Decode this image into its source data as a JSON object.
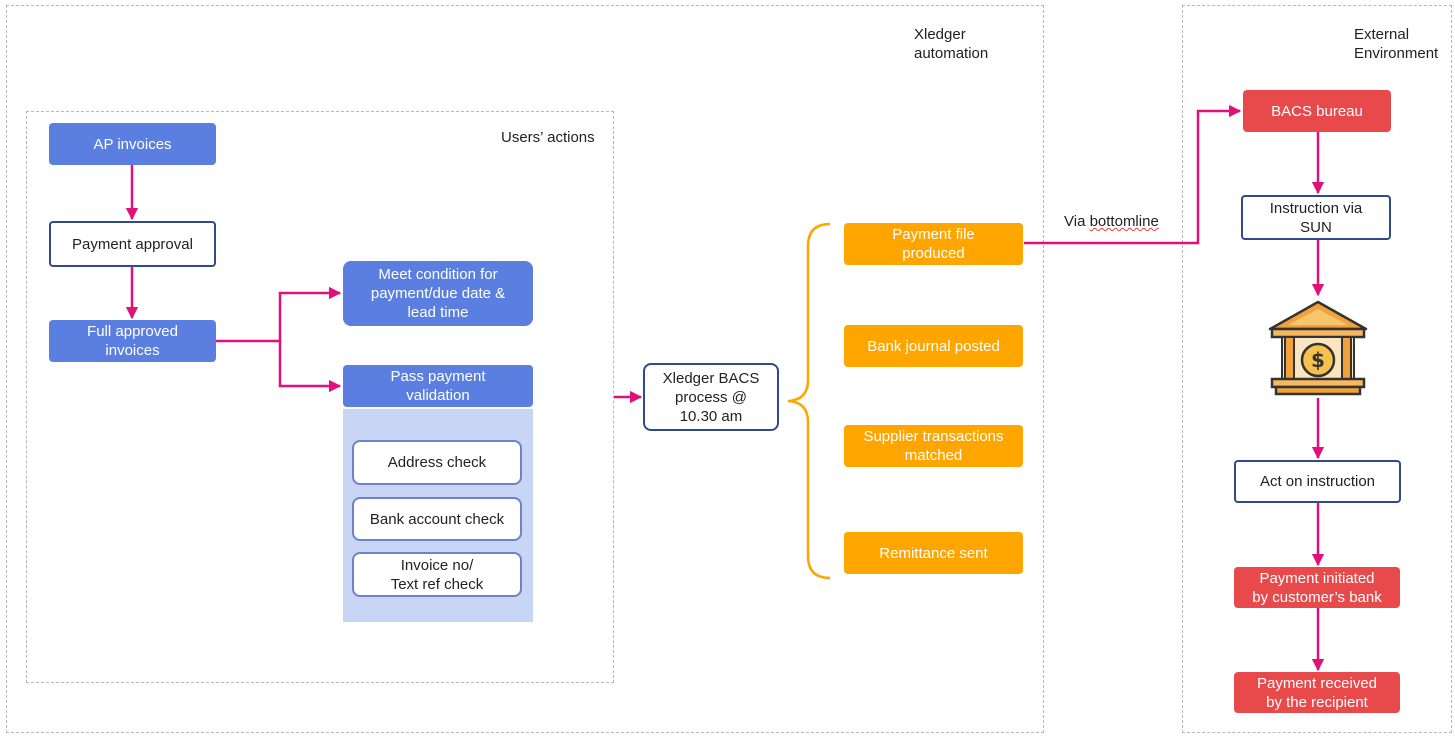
{
  "regions": {
    "xledger": {
      "label": "Xledger\nautomation"
    },
    "users": {
      "label": "Users’ actions"
    },
    "external": {
      "label": "External\nEnvironment"
    }
  },
  "nodes": {
    "ap_invoices": "AP invoices",
    "payment_approval": "Payment approval",
    "full_approved": "Full approved\ninvoices",
    "meet_condition": "Meet condition for\npayment/due date &\nlead time",
    "pass_validation": "Pass payment\nvalidation",
    "address_check": "Address check",
    "bank_account_check": "Bank account check",
    "invoice_text_check": "Invoice no/\nText ref check",
    "xledger_bacs": "Xledger BACS\nprocess @\n10.30 am",
    "payment_file": "Payment file\nproduced",
    "bank_journal": "Bank journal posted",
    "supplier_matched": "Supplier transactions\nmatched",
    "remittance_sent": "Remittance sent",
    "bacs_bureau": "BACS bureau",
    "instruction_sun": "Instruction via\nSUN",
    "act_on_instruction": "Act on instruction",
    "payment_initiated": "Payment initiated\nby customer’s bank",
    "payment_received": "Payment received\nby the recipient"
  },
  "edges": {
    "via_prefix": "Via ",
    "via_word": "bottomline"
  },
  "icons": {
    "bank": "bank-building-icon"
  },
  "colors": {
    "arrow": "#e0117a",
    "brace": "#ffa500",
    "blue": "#5b7fe0",
    "orange": "#ffa500",
    "red": "#e8494a",
    "outline": "#2f4b8c"
  }
}
